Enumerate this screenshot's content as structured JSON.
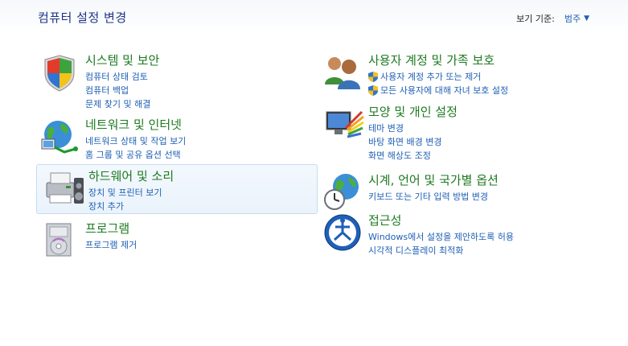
{
  "header": {
    "title": "컴퓨터 설정 변경",
    "view_label": "보기 기준:",
    "view_value": "범주"
  },
  "categories": {
    "system": {
      "title": "시스템 및 보안",
      "icon": "security-shield-icon",
      "links": [
        "컴퓨터 상태 검토",
        "컴퓨터 백업",
        "문제 찾기 및 해결"
      ]
    },
    "network": {
      "title": "네트워크 및 인터넷",
      "icon": "network-globe-icon",
      "links": [
        "네트워크 상태 및 작업 보기",
        "홈 그룹 및 공유 옵션 선택"
      ]
    },
    "hardware": {
      "title": "하드웨어 및 소리",
      "icon": "printer-speaker-icon",
      "links": [
        "장치 및 프린터 보기",
        "장치 추가"
      ]
    },
    "programs": {
      "title": "프로그램",
      "icon": "programs-disc-icon",
      "links": [
        "프로그램 제거"
      ]
    },
    "users": {
      "title": "사용자 계정 및 가족 보호",
      "icon": "users-icon",
      "links": [
        "사용자 계정 추가 또는 제거",
        "모든 사용자에 대해 자녀 보호 설정"
      ]
    },
    "appearance": {
      "title": "모양 및 개인 설정",
      "icon": "monitor-palette-icon",
      "links": [
        "테마 변경",
        "바탕 화면 배경 변경",
        "화면 해상도 조정"
      ]
    },
    "clock": {
      "title": "시계, 언어 및 국가별 옵션",
      "icon": "globe-clock-icon",
      "links": [
        "키보드 또는 기타 입력 방법 변경"
      ]
    },
    "access": {
      "title": "접근성",
      "icon": "ease-of-access-icon",
      "links": [
        "Windows에서 설정을 제안하도록 허용",
        "시각적 디스플레이 최적화"
      ]
    }
  },
  "colors": {
    "title_green": "#1d7a20",
    "link_blue": "#1e5fb4",
    "header_blue": "#1e3287"
  }
}
